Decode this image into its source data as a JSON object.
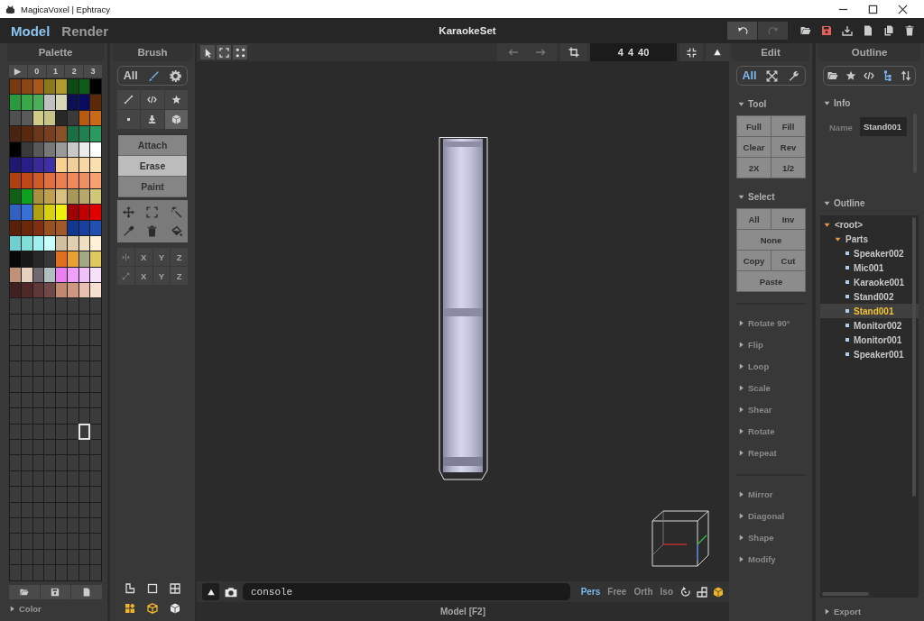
{
  "window": {
    "title": "MagicaVoxel | Ephtracy"
  },
  "modes": [
    {
      "label": "Model",
      "selected": true
    },
    {
      "label": "Render",
      "selected": false
    }
  ],
  "document": {
    "title": "KaraokeSet"
  },
  "history": [
    {
      "kind": "undo",
      "disabled": false
    },
    {
      "kind": "redo",
      "disabled": true
    }
  ],
  "palette": {
    "title": "Palette",
    "page_tabs": [
      "▶",
      "0",
      "1",
      "2",
      "3"
    ],
    "swatches": [
      {
        "color": "#7a3a10",
        "selected": false
      },
      {
        "color": "#8a4614",
        "selected": false
      },
      {
        "color": "#a8581c",
        "selected": false
      },
      {
        "color": "#8a7a1c",
        "selected": false
      },
      {
        "color": "#b09a30",
        "selected": false
      },
      {
        "color": "#0e4a14",
        "selected": false
      },
      {
        "color": "#0e5a18",
        "selected": false
      },
      {
        "color": "#000000",
        "selected": false
      },
      {
        "color": "#2a9a3e",
        "selected": false
      },
      {
        "color": "#38a848",
        "selected": false
      },
      {
        "color": "#4aae5a",
        "selected": false
      },
      {
        "color": "#c0c0c0",
        "selected": false
      },
      {
        "color": "#d8d8b8",
        "selected": false
      },
      {
        "color": "#0a1050",
        "selected": false
      },
      {
        "color": "#0a0a60",
        "selected": false
      },
      {
        "color": "#5a2a0a",
        "selected": false
      },
      {
        "color": "#505050",
        "selected": false
      },
      {
        "color": "#5a5a5a",
        "selected": false
      },
      {
        "color": "#d0cc88",
        "selected": false
      },
      {
        "color": "#c8c488",
        "selected": false
      },
      {
        "color": "#282828",
        "selected": false
      },
      {
        "color": "#3a3a3a",
        "selected": false
      },
      {
        "color": "#b85a10",
        "selected": false
      },
      {
        "color": "#c86a1a",
        "selected": false
      },
      {
        "color": "#4a2410",
        "selected": false
      },
      {
        "color": "#5a2a10",
        "selected": false
      },
      {
        "color": "#6a3818",
        "selected": false
      },
      {
        "color": "#784020",
        "selected": false
      },
      {
        "color": "#8a5028",
        "selected": false
      },
      {
        "color": "#1a7040",
        "selected": false
      },
      {
        "color": "#208050",
        "selected": false
      },
      {
        "color": "#2a9a60",
        "selected": false
      },
      {
        "color": "#000000",
        "selected": false
      },
      {
        "color": "#3a3a3a",
        "selected": false
      },
      {
        "color": "#585858",
        "selected": false
      },
      {
        "color": "#787878",
        "selected": false
      },
      {
        "color": "#9a9a9a",
        "selected": false
      },
      {
        "color": "#c8c8c8",
        "selected": false
      },
      {
        "color": "#ececec",
        "selected": false
      },
      {
        "color": "#ffffff",
        "selected": false
      },
      {
        "color": "#201870",
        "selected": false
      },
      {
        "color": "#281e88",
        "selected": false
      },
      {
        "color": "#3a2a98",
        "selected": false
      },
      {
        "color": "#4030a8",
        "selected": false
      },
      {
        "color": "#f8d090",
        "selected": false
      },
      {
        "color": "#f0d098",
        "selected": false
      },
      {
        "color": "#f8d8a0",
        "selected": false
      },
      {
        "color": "#f8e0b0",
        "selected": false
      },
      {
        "color": "#b04010",
        "selected": false
      },
      {
        "color": "#c04818",
        "selected": false
      },
      {
        "color": "#d05a28",
        "selected": false
      },
      {
        "color": "#e07040",
        "selected": false
      },
      {
        "color": "#e88050",
        "selected": false
      },
      {
        "color": "#f08858",
        "selected": false
      },
      {
        "color": "#f09060",
        "selected": false
      },
      {
        "color": "#f8a070",
        "selected": false
      },
      {
        "color": "#106018",
        "selected": false
      },
      {
        "color": "#10a020",
        "selected": false
      },
      {
        "color": "#a89040",
        "selected": false
      },
      {
        "color": "#c0a050",
        "selected": false
      },
      {
        "color": "#d8c080",
        "selected": false
      },
      {
        "color": "#a89858",
        "selected": false
      },
      {
        "color": "#b8a868",
        "selected": false
      },
      {
        "color": "#d0c878",
        "selected": false
      },
      {
        "color": "#3060c0",
        "selected": false
      },
      {
        "color": "#3870d8",
        "selected": false
      },
      {
        "color": "#b0a010",
        "selected": false
      },
      {
        "color": "#d8d010",
        "selected": false
      },
      {
        "color": "#f0f010",
        "selected": false
      },
      {
        "color": "#a00000",
        "selected": false
      },
      {
        "color": "#c00000",
        "selected": false
      },
      {
        "color": "#e00000",
        "selected": false
      },
      {
        "color": "#5a2008",
        "selected": false
      },
      {
        "color": "#6a2808",
        "selected": false
      },
      {
        "color": "#803010",
        "selected": false
      },
      {
        "color": "#985020",
        "selected": false
      },
      {
        "color": "#a05828",
        "selected": false
      },
      {
        "color": "#103890",
        "selected": false
      },
      {
        "color": "#1840a0",
        "selected": false
      },
      {
        "color": "#2050b0",
        "selected": false
      },
      {
        "color": "#70d0d0",
        "selected": false
      },
      {
        "color": "#80e0d8",
        "selected": false
      },
      {
        "color": "#a0f0f0",
        "selected": false
      },
      {
        "color": "#c8ffff",
        "selected": false
      },
      {
        "color": "#d0c0a0",
        "selected": false
      },
      {
        "color": "#e0d0b0",
        "selected": false
      },
      {
        "color": "#f0e0c0",
        "selected": false
      },
      {
        "color": "#fff0d8",
        "selected": false
      },
      {
        "color": "#080808",
        "selected": false
      },
      {
        "color": "#181818",
        "selected": false
      },
      {
        "color": "#282828",
        "selected": false
      },
      {
        "color": "#383838",
        "selected": false
      },
      {
        "color": "#e07020",
        "selected": false
      },
      {
        "color": "#e8a030",
        "selected": false
      },
      {
        "color": "#a0a888",
        "selected": false
      },
      {
        "color": "#e0c860",
        "selected": false
      },
      {
        "color": "#c09078",
        "selected": false
      },
      {
        "color": "#e8d0c0",
        "selected": false
      },
      {
        "color": "#706870",
        "selected": false
      },
      {
        "color": "#b0c0c0",
        "selected": false
      },
      {
        "color": "#e880f0",
        "selected": false
      },
      {
        "color": "#f0a0f8",
        "selected": false
      },
      {
        "color": "#f0c0f8",
        "selected": false
      },
      {
        "color": "#f8e0f8",
        "selected": false
      },
      {
        "color": "#402020",
        "selected": false
      },
      {
        "color": "#502828",
        "selected": false
      },
      {
        "color": "#603838",
        "selected": false
      },
      {
        "color": "#704848",
        "selected": false
      },
      {
        "color": "#c08870",
        "selected": false
      },
      {
        "color": "#d09880",
        "selected": false
      },
      {
        "color": "#e8c0b0",
        "selected": false
      },
      {
        "color": "#f8e0d0",
        "selected": false
      },
      {
        "selected": false
      },
      {
        "selected": false
      },
      {
        "selected": false
      },
      {
        "selected": false
      },
      {
        "selected": false
      },
      {
        "selected": false
      },
      {
        "selected": false
      },
      {
        "selected": false
      },
      {
        "selected": false
      },
      {
        "selected": false
      },
      {
        "selected": false
      },
      {
        "selected": false
      },
      {
        "selected": false
      },
      {
        "selected": false
      },
      {
        "selected": false
      },
      {
        "selected": false
      },
      {
        "selected": false
      },
      {
        "selected": false
      },
      {
        "selected": false
      },
      {
        "selected": false
      },
      {
        "selected": false
      },
      {
        "selected": false
      },
      {
        "selected": false
      },
      {
        "selected": false
      },
      {
        "selected": false
      },
      {
        "selected": false
      },
      {
        "selected": false
      },
      {
        "selected": false
      },
      {
        "selected": false
      },
      {
        "selected": false
      },
      {
        "selected": false
      },
      {
        "selected": false
      },
      {
        "selected": false
      },
      {
        "selected": false
      },
      {
        "selected": false
      },
      {
        "selected": false
      },
      {
        "selected": false
      },
      {
        "selected": false
      },
      {
        "selected": false
      },
      {
        "selected": false
      },
      {
        "selected": false
      },
      {
        "selected": false
      },
      {
        "selected": false
      },
      {
        "selected": false
      },
      {
        "selected": false
      },
      {
        "selected": false
      },
      {
        "selected": false
      },
      {
        "selected": false
      },
      {
        "selected": false
      },
      {
        "selected": false
      },
      {
        "selected": false
      },
      {
        "selected": false
      },
      {
        "selected": false
      },
      {
        "selected": false
      },
      {
        "selected": false
      },
      {
        "selected": false
      },
      {
        "selected": false
      },
      {
        "selected": false
      },
      {
        "selected": false
      },
      {
        "selected": false
      },
      {
        "selected": false
      },
      {
        "selected": false
      },
      {
        "selected": false
      },
      {
        "selected": false
      },
      {
        "selected": false
      },
      {
        "selected": false
      },
      {
        "selected": false
      },
      {
        "selected": false
      },
      {
        "selected": false
      },
      {
        "selected": false
      },
      {
        "selected": true
      },
      {
        "selected": false
      },
      {
        "selected": false
      },
      {
        "selected": false
      },
      {
        "selected": false
      },
      {
        "selected": false
      },
      {
        "selected": false
      },
      {
        "selected": false
      },
      {
        "selected": false
      },
      {
        "selected": false
      },
      {
        "selected": false
      },
      {
        "selected": false
      },
      {
        "selected": false
      },
      {
        "selected": false
      },
      {
        "selected": false
      },
      {
        "selected": false
      },
      {
        "selected": false
      },
      {
        "selected": false
      },
      {
        "selected": false
      },
      {
        "selected": false
      },
      {
        "selected": false
      },
      {
        "selected": false
      },
      {
        "selected": false
      },
      {
        "selected": false
      },
      {
        "selected": false
      },
      {
        "selected": false
      },
      {
        "selected": false
      },
      {
        "selected": false
      },
      {
        "selected": false
      },
      {
        "selected": false
      },
      {
        "selected": false
      },
      {
        "selected": false
      },
      {
        "selected": false
      },
      {
        "selected": false
      },
      {
        "selected": false
      },
      {
        "selected": false
      },
      {
        "selected": false
      },
      {
        "selected": false
      },
      {
        "selected": false
      },
      {
        "selected": false
      },
      {
        "selected": false
      },
      {
        "selected": false
      },
      {
        "selected": false
      },
      {
        "selected": false
      },
      {
        "selected": false
      },
      {
        "selected": false
      },
      {
        "selected": false
      },
      {
        "selected": false
      },
      {
        "selected": false
      },
      {
        "selected": false
      },
      {
        "selected": false
      },
      {
        "selected": false
      },
      {
        "selected": false
      },
      {
        "selected": false
      },
      {
        "selected": false
      },
      {
        "selected": false
      },
      {
        "selected": false
      },
      {
        "selected": false
      },
      {
        "selected": false
      },
      {
        "selected": false
      },
      {
        "selected": false
      },
      {
        "selected": false
      },
      {
        "selected": false
      },
      {
        "selected": false
      },
      {
        "selected": false
      },
      {
        "selected": false
      },
      {
        "selected": false
      },
      {
        "selected": false
      },
      {
        "selected": false
      },
      {
        "selected": false
      },
      {
        "selected": false
      },
      {
        "selected": false
      },
      {
        "selected": false
      },
      {
        "selected": false
      }
    ],
    "footer": {
      "label": "Color",
      "expanded": false
    }
  },
  "brush": {
    "title": "Brush",
    "filters": [
      {
        "kind": "text",
        "label": "All",
        "selected": false
      },
      {
        "kind": "brush",
        "selected": true
      },
      {
        "kind": "gear",
        "selected": false
      }
    ],
    "shapes": [
      {
        "kind": "line",
        "selected": false
      },
      {
        "kind": "code",
        "selected": false
      },
      {
        "kind": "star",
        "selected": false
      },
      {
        "kind": "point",
        "selected": false
      },
      {
        "kind": "pin",
        "selected": false
      },
      {
        "kind": "cube",
        "selected": true
      }
    ],
    "modes": [
      {
        "label": "Attach",
        "selected": false
      },
      {
        "label": "Erase",
        "selected": true
      },
      {
        "label": "Paint",
        "selected": false
      }
    ],
    "axis_rows": [
      {
        "kind": "mirror",
        "labels": [
          "X",
          "Y",
          "Z"
        ]
      },
      {
        "kind": "resize",
        "labels": [
          "X",
          "Y",
          "Z"
        ]
      }
    ]
  },
  "viewport": {
    "size": "4 4 40",
    "console": {
      "placeholder": "console"
    },
    "cameras": [
      {
        "label": "Pers",
        "selected": true
      },
      {
        "label": "Free",
        "selected": false
      },
      {
        "label": "Orth",
        "selected": false
      },
      {
        "label": "Iso",
        "selected": false
      }
    ],
    "status": "Model [F2]"
  },
  "edit": {
    "title": "Edit",
    "filters": [
      {
        "kind": "text",
        "label": "All",
        "selected": true
      },
      {
        "kind": "fit",
        "selected": false
      },
      {
        "kind": "wrench",
        "selected": false
      }
    ],
    "groups": [
      {
        "sections": [
          {
            "label": "Tool",
            "expanded": true,
            "rows": [
              [
                "Full",
                "Fill"
              ],
              [
                "Clear",
                "Rev"
              ],
              [
                "2X",
                "1/2"
              ]
            ]
          },
          {
            "label": "Select",
            "expanded": true,
            "rows": [
              [
                "All",
                "Inv"
              ],
              [
                "None"
              ],
              [
                "Copy",
                "Cut"
              ],
              [
                "Paste"
              ]
            ]
          }
        ]
      },
      {
        "sections": [
          {
            "label": "Rotate 90°",
            "expanded": false
          },
          {
            "label": "Flip",
            "expanded": false
          },
          {
            "label": "Loop",
            "expanded": false
          },
          {
            "label": "Scale",
            "expanded": false
          },
          {
            "label": "Shear",
            "expanded": false
          },
          {
            "label": "Rotate",
            "expanded": false
          },
          {
            "label": "Repeat",
            "expanded": false
          }
        ]
      },
      {
        "sections": [
          {
            "label": "Mirror",
            "expanded": false
          },
          {
            "label": "Diagonal",
            "expanded": false
          },
          {
            "label": "Shape",
            "expanded": false
          },
          {
            "label": "Modify",
            "expanded": false
          }
        ]
      }
    ]
  },
  "outline": {
    "title": "Outline",
    "tools": [
      {
        "kind": "folder",
        "selected": false
      },
      {
        "kind": "star",
        "selected": false
      },
      {
        "kind": "code",
        "selected": false
      },
      {
        "kind": "tree",
        "selected": true
      },
      {
        "kind": "sort",
        "selected": false
      }
    ],
    "info": {
      "label": "Info",
      "expanded": true,
      "name_label": "Name",
      "name_value": "Stand001"
    },
    "tree_section": {
      "label": "Outline",
      "expanded": true,
      "tree": [
        {
          "label": "<root>",
          "expanded": true,
          "selected": false,
          "children": [
            {
              "label": "Parts",
              "expanded": true,
              "selected": false,
              "children": [
                {
                  "label": "Speaker002",
                  "selected": false
                },
                {
                  "label": "Mic001",
                  "selected": false
                },
                {
                  "label": "Karaoke001",
                  "selected": false
                },
                {
                  "label": "Stand002",
                  "selected": false
                },
                {
                  "label": "Stand001",
                  "selected": true
                },
                {
                  "label": "Monitor002",
                  "selected": false
                },
                {
                  "label": "Monitor001",
                  "selected": false
                },
                {
                  "label": "Speaker001",
                  "selected": false
                }
              ]
            }
          ]
        }
      ]
    },
    "export": {
      "label": "Export",
      "expanded": false
    }
  }
}
